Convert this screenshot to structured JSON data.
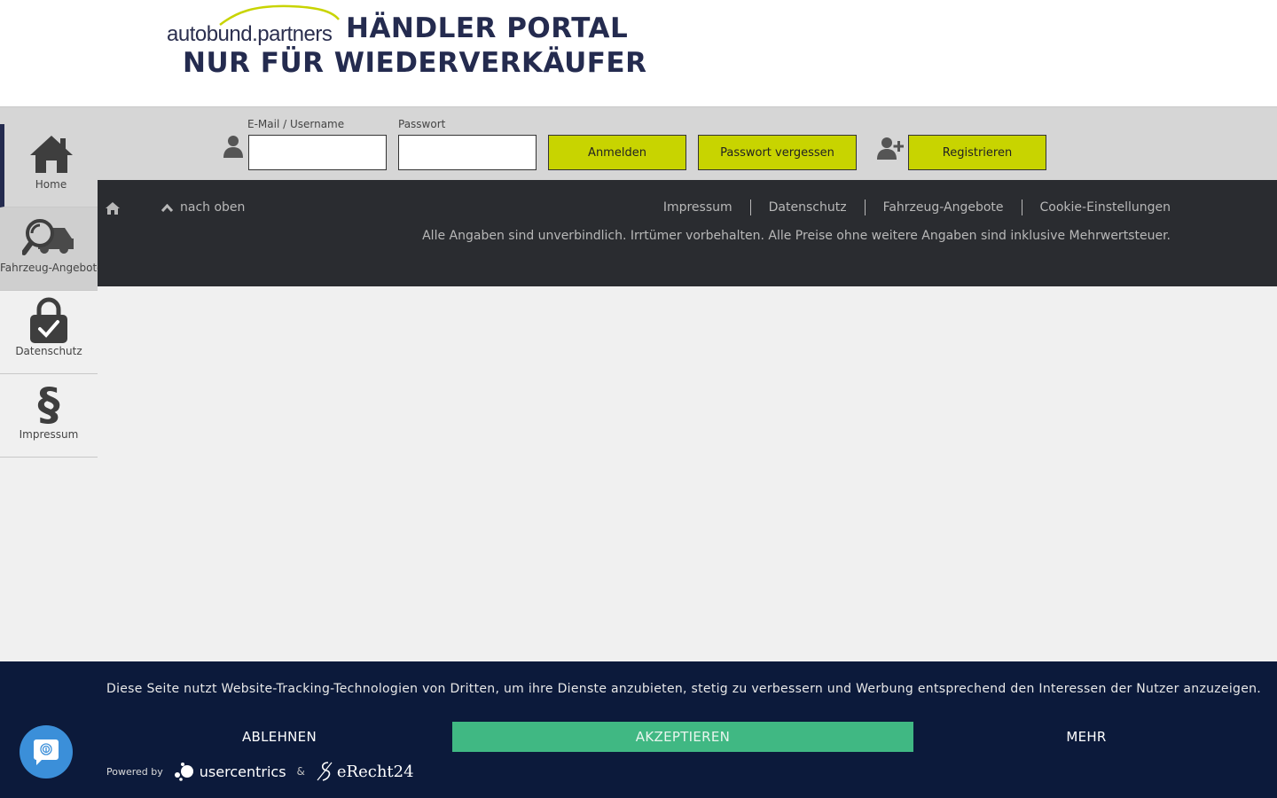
{
  "header": {
    "logo_brand": "autobund.partners",
    "logo_line1": "HÄNDLER PORTAL",
    "logo_line2": "NUR FÜR WIEDERVERKÄUFER"
  },
  "login": {
    "email_label": "E-Mail / Username",
    "email_value": "",
    "password_label": "Passwort",
    "password_value": "",
    "login_button": "Anmelden",
    "forgot_button": "Passwort vergessen",
    "register_button": "Registrieren"
  },
  "sidebar": {
    "items": [
      {
        "label": "Home",
        "icon": "home-icon"
      },
      {
        "label": "Fahrzeug-Angebote",
        "icon": "car-search-icon"
      },
      {
        "label": "Datenschutz",
        "icon": "lock-check-icon"
      },
      {
        "label": "Impressum",
        "icon": "paragraph-icon"
      }
    ]
  },
  "footer": {
    "up_link": "nach oben",
    "links": [
      "Impressum",
      "Datenschutz",
      "Fahrzeug-Angebote",
      "Cookie-Einstellungen"
    ],
    "disclaimer": "Alle Angaben sind unverbindlich. Irrtümer vorbehalten. Alle Preise ohne weitere Angaben sind inklusive Mehrwertsteuer."
  },
  "cookie": {
    "text": "Diese Seite nutzt Website-Tracking-Technologien von Dritten, um ihre Dienste anzubieten, stetig zu verbessern und Werbung entsprechend den Interessen der Nutzer anzuzeigen.",
    "decline": "ABLEHNEN",
    "accept": "AKZEPTIEREN",
    "more": "MEHR",
    "powered_by": "Powered by",
    "usercentrics": "usercentrics",
    "amp": "&",
    "erecht": "eRecht24"
  },
  "colors": {
    "accent_button": "#c8d400",
    "brand_navy": "#242b4f",
    "footer_bg": "#2a2c30",
    "cookie_bg": "#0c1a3b",
    "accept_green": "#40b883",
    "fab_blue": "#3b8fd9"
  }
}
